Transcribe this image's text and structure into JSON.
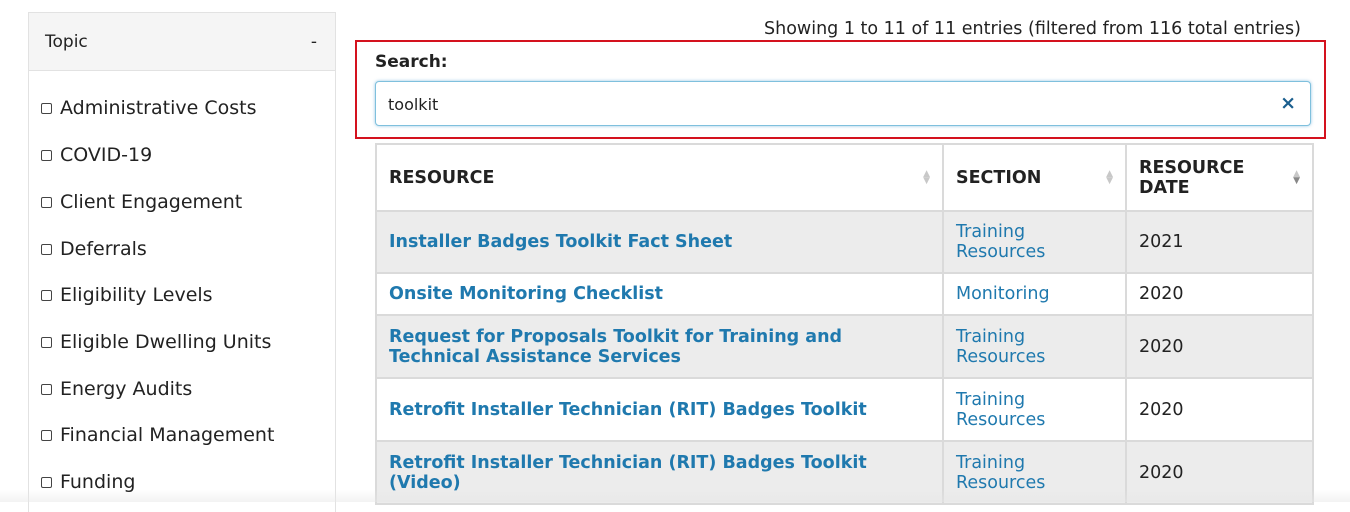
{
  "sidebar": {
    "title": "Topic",
    "toggle": "-",
    "topics": [
      "Administrative Costs",
      "COVID-19",
      "Client Engagement",
      "Deferrals",
      "Eligibility Levels",
      "Eligible Dwelling Units",
      "Energy Audits",
      "Financial Management",
      "Funding"
    ]
  },
  "info": "Showing 1 to 11 of 11 entries (filtered from 116 total entries)",
  "search": {
    "label": "Search:",
    "value": "toolkit",
    "clear_icon": "×",
    "highlight_color": "#d4121e"
  },
  "table": {
    "headers": [
      "RESOURCE",
      "SECTION",
      "RESOURCE DATE"
    ],
    "rows": [
      {
        "resource": "Installer Badges Toolkit Fact Sheet",
        "section": "Training Resources",
        "date": "2021"
      },
      {
        "resource": "Onsite Monitoring Checklist",
        "section": "Monitoring",
        "date": "2020"
      },
      {
        "resource": "Request for Proposals Toolkit for Training and Technical Assistance Services",
        "section": "Training Resources",
        "date": "2020"
      },
      {
        "resource": "Retrofit Installer Technician (RIT) Badges Toolkit",
        "section": "Training Resources",
        "date": "2020"
      },
      {
        "resource": "Retrofit Installer Technician (RIT) Badges Toolkit (Video)",
        "section": "Training Resources",
        "date": "2020"
      }
    ]
  },
  "colors": {
    "link": "#1f79ae",
    "row_stripe": "#ececec",
    "focus_border": "#7fc0dd"
  }
}
